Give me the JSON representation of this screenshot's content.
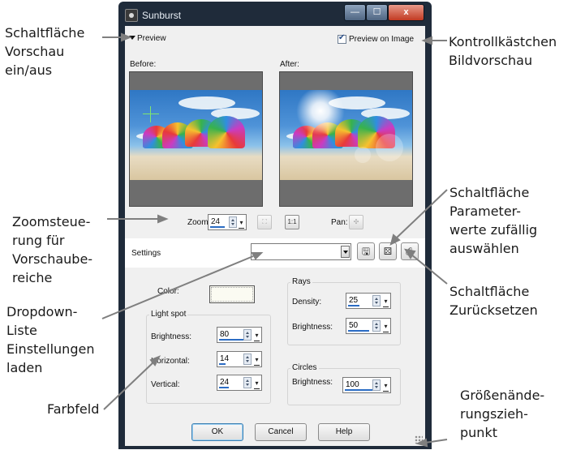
{
  "window": {
    "title": "Sunburst",
    "min_glyph": "—",
    "max_glyph": "☐",
    "close_glyph": "x"
  },
  "preview": {
    "toggle_label": "Preview",
    "on_image_label": "Preview on Image",
    "on_image_checked": true,
    "before_label": "Before:",
    "after_label": "After:"
  },
  "zoom": {
    "label": "Zoom:",
    "value": "24",
    "fit_glyph": "⛶",
    "one_to_one_label": "1:1",
    "pan_label": "Pan:",
    "pan_glyph": "✣"
  },
  "settings": {
    "label": "Settings",
    "value": ""
  },
  "color": {
    "label": "Color:",
    "value_hex": "#fbfbf2"
  },
  "light_spot": {
    "title": "Light spot",
    "brightness": {
      "label": "Brightness:",
      "value": "80"
    },
    "horizontal": {
      "label": "Horizontal:",
      "value": "14"
    },
    "vertical": {
      "label": "Vertical:",
      "value": "24"
    }
  },
  "rays": {
    "title": "Rays",
    "density": {
      "label": "Density:",
      "value": "25"
    },
    "brightness": {
      "label": "Brightness:",
      "value": "50"
    }
  },
  "circles": {
    "title": "Circles",
    "brightness": {
      "label": "Brightness:",
      "value": "100"
    }
  },
  "buttons": {
    "ok": "OK",
    "cancel": "Cancel",
    "help": "Help"
  },
  "callouts": {
    "preview_toggle": "Schaltfläche\nVorschau\nein/aus",
    "preview_on_image": "Kontrollkästchen\nBildvorschau",
    "zoom": "Zoomsteue-\nrung für\nVorschaube-\nreiche",
    "settings_dropdown": "Dropdown-\nListe\nEinstellungen\nladen",
    "color_swatch": "Farbfeld",
    "randomize": "Schaltfläche\nParameter-\nwerte zufällig\nauswählen",
    "reset": "Schaltfläche\nZurücksetzen",
    "resize_grip": "Größenände-\nrungszieh-\npunkt"
  },
  "colors": {
    "titlebar": "#1f2b3a",
    "client": "#f0f0f0",
    "accent": "#2b6cc4"
  }
}
